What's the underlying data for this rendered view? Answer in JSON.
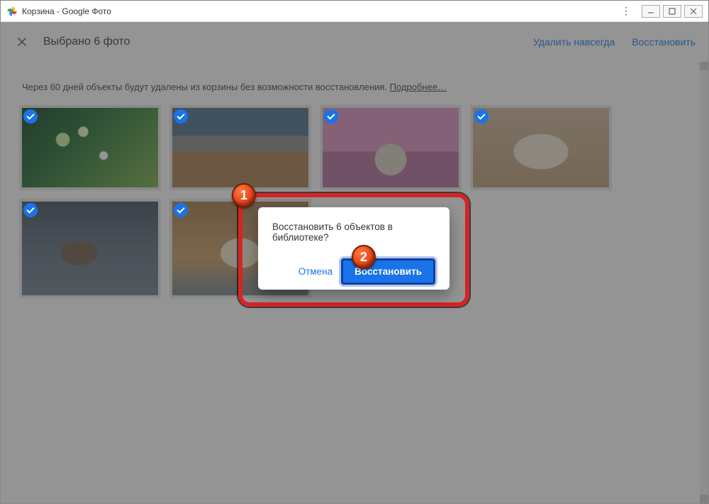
{
  "window": {
    "title": "Корзина - Google Фото"
  },
  "topbar": {
    "selection": "Выбрано 6 фото",
    "delete_forever": "Удалить навсегда",
    "restore": "Восстановить"
  },
  "info": {
    "text": "Через 60 дней объекты будут удалены из корзины без возможности восстановления. ",
    "link": "Подробнее…"
  },
  "dialog": {
    "message": "Восстановить 6 объектов в библиотеке?",
    "cancel": "Отмена",
    "restore": "Восстановить"
  },
  "badges": {
    "one": "1",
    "two": "2"
  }
}
